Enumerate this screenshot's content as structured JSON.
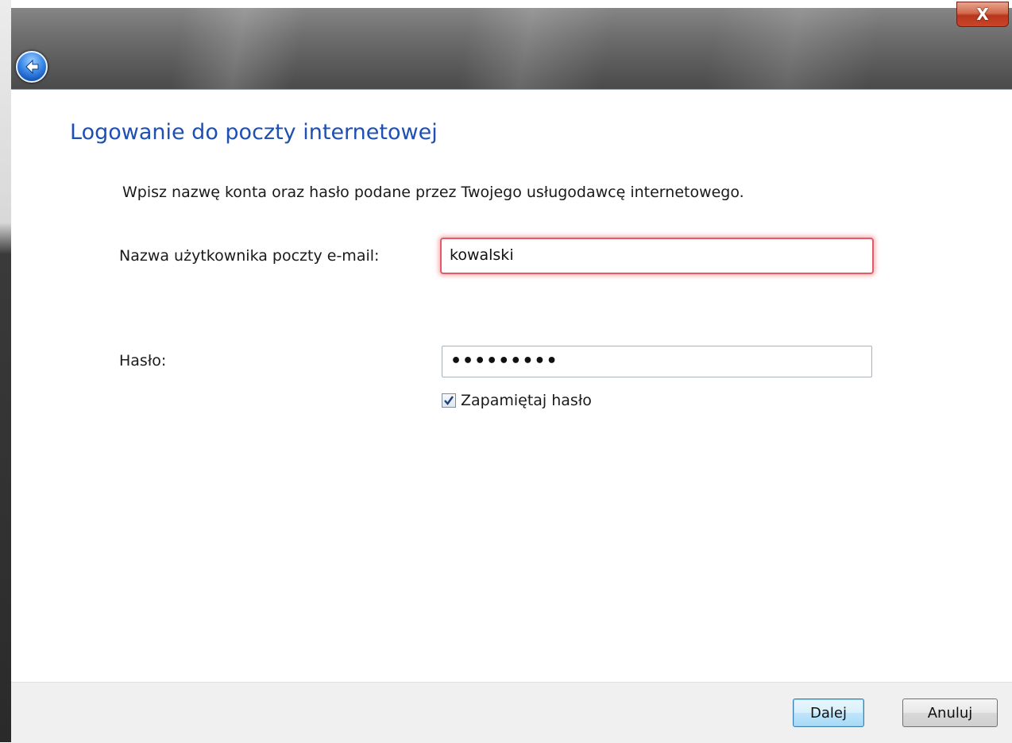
{
  "window": {
    "close_glyph": "X",
    "back_icon": "back-arrow-icon"
  },
  "main": {
    "title": "Logowanie do poczty internetowej",
    "instruction": "Wpisz nazwę konta oraz hasło podane przez Twojego usługodawcę internetowego.",
    "username_label": "Nazwa użytkownika poczty e-mail:",
    "username_value": "kowalski",
    "password_label": "Hasło:",
    "password_value": "•••••••••",
    "remember_label": "Zapamiętaj hasło",
    "remember_checked": true
  },
  "footer": {
    "next_label": "Dalej",
    "cancel_label": "Anuluj"
  },
  "colors": {
    "title_blue": "#1e4fb4",
    "error_red": "#e25b66"
  }
}
